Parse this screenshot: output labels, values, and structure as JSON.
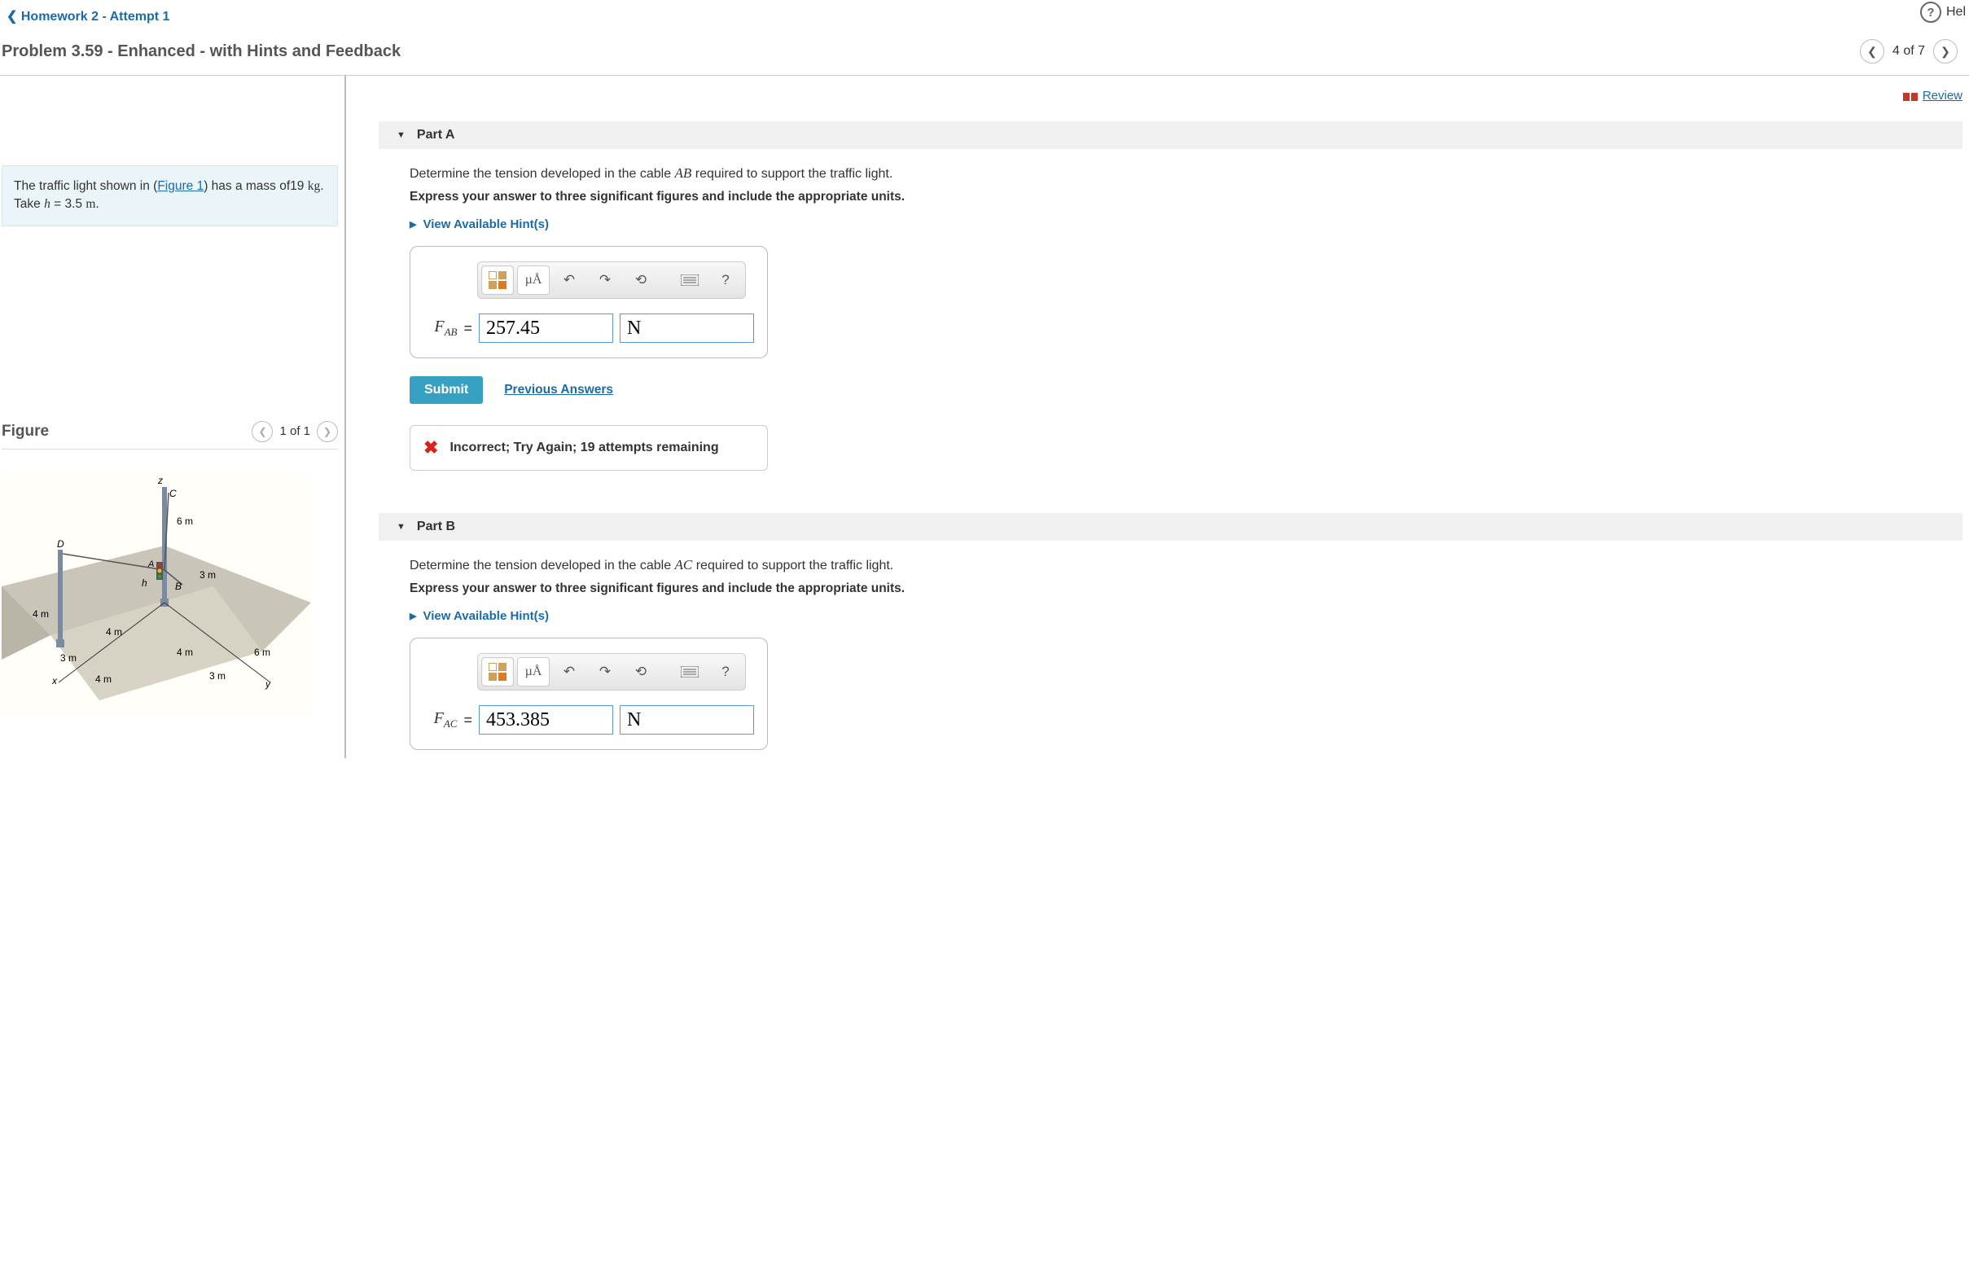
{
  "help_label": "Hel",
  "breadcrumb": {
    "label": "Homework 2 - Attempt 1"
  },
  "title": "Problem 3.59 - Enhanced - with Hints and Feedback",
  "top_pager": "4 of 7",
  "review_link": "Review",
  "problem": {
    "pre": "The traffic light shown in (",
    "figure_link": "Figure 1",
    "post1": ") has a mass of",
    "mass_val": "19",
    "mass_unit": "kg",
    "post2": ". Take ",
    "h_var": "h",
    "h_eq": " = 3.5 ",
    "h_unit": "m",
    "post3": "."
  },
  "figure": {
    "title": "Figure",
    "pager": "1 of 1",
    "labels": {
      "z": "z",
      "C": "C",
      "six_m_top": "6 m",
      "D": "D",
      "A": "A",
      "three_m_r": "3 m",
      "h": "h",
      "B": "B",
      "four_m_l": "4 m",
      "four_m_lb": "4 m",
      "three_m_lb": "3 m",
      "x": "x",
      "four_m_rb": "4 m",
      "four_m_mid": "4 m",
      "six_m_rb": "6 m",
      "three_m_rb": "3 m",
      "y": "y"
    }
  },
  "parts": {
    "a": {
      "header": "Part A",
      "prompt_pre": "Determine the tension developed in the cable ",
      "cable": "AB",
      "prompt_post": " required to support the traffic light.",
      "express": "Express your answer to three significant figures and include the appropriate units.",
      "hints": "View Available Hint(s)",
      "var": "F",
      "sub": "AB",
      "value": "257.45",
      "unit": "N",
      "submit": "Submit",
      "prev": "Previous Answers",
      "feedback": "Incorrect; Try Again; 19 attempts remaining"
    },
    "b": {
      "header": "Part B",
      "prompt_pre": "Determine the tension developed in the cable ",
      "cable": "AC",
      "prompt_post": " required to support the traffic light.",
      "express": "Express your answer to three significant figures and include the appropriate units.",
      "hints": "View Available Hint(s)",
      "var": "F",
      "sub": "AC",
      "value": "453.385",
      "unit": "N"
    }
  },
  "toolbar": {
    "ua": "µÅ",
    "help": "?"
  }
}
